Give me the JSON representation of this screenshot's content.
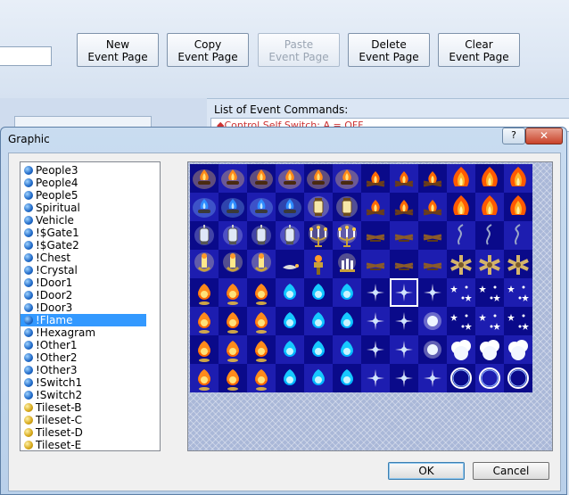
{
  "background": {
    "buttons": [
      {
        "line1": "New",
        "line2": "Event Page",
        "disabled": false
      },
      {
        "line1": "Copy",
        "line2": "Event Page",
        "disabled": false
      },
      {
        "line1": "Paste",
        "line2": "Event Page",
        "disabled": true
      },
      {
        "line1": "Delete",
        "line2": "Event Page",
        "disabled": false
      },
      {
        "line1": "Clear",
        "line2": "Event Page",
        "disabled": false
      }
    ],
    "list_label": "List of Event Commands:",
    "first_command": "◆Control Self Switch: A = OFF"
  },
  "dialog": {
    "title": "Graphic",
    "help_label": "?",
    "close_label": "✕",
    "ok_label": "OK",
    "cancel_label": "Cancel"
  },
  "list": {
    "selected": "!Flame",
    "items": [
      {
        "label": "People3",
        "icon": "blue"
      },
      {
        "label": "People4",
        "icon": "blue"
      },
      {
        "label": "People5",
        "icon": "blue"
      },
      {
        "label": "Spiritual",
        "icon": "blue"
      },
      {
        "label": "Vehicle",
        "icon": "blue"
      },
      {
        "label": "!$Gate1",
        "icon": "blue"
      },
      {
        "label": "!$Gate2",
        "icon": "blue"
      },
      {
        "label": "!Chest",
        "icon": "blue"
      },
      {
        "label": "!Crystal",
        "icon": "blue"
      },
      {
        "label": "!Door1",
        "icon": "blue"
      },
      {
        "label": "!Door2",
        "icon": "blue"
      },
      {
        "label": "!Door3",
        "icon": "blue"
      },
      {
        "label": "!Flame",
        "icon": "blue"
      },
      {
        "label": "!Hexagram",
        "icon": "blue"
      },
      {
        "label": "!Other1",
        "icon": "blue"
      },
      {
        "label": "!Other2",
        "icon": "blue"
      },
      {
        "label": "!Other3",
        "icon": "blue"
      },
      {
        "label": "!Switch1",
        "icon": "blue"
      },
      {
        "label": "!Switch2",
        "icon": "blue"
      },
      {
        "label": "Tileset-B",
        "icon": "gold"
      },
      {
        "label": "Tileset-C",
        "icon": "gold"
      },
      {
        "label": "Tileset-D",
        "icon": "gold"
      },
      {
        "label": "Tileset-E",
        "icon": "gold"
      }
    ]
  },
  "sheet": {
    "columns": 12,
    "rows": 8,
    "selected_cell": {
      "row": 4,
      "col": 7
    },
    "row_types": [
      [
        "torch-orange",
        "torch-orange",
        "torch-orange",
        "torch-orange",
        "torch-orange",
        "torch-orange",
        "campfire",
        "campfire",
        "campfire",
        "big-flame",
        "big-flame",
        "big-flame"
      ],
      [
        "torch-blue",
        "torch-blue",
        "torch-blue",
        "torch-blue",
        "lantern",
        "lantern",
        "campfire",
        "campfire",
        "campfire",
        "big-flame",
        "big-flame",
        "big-flame"
      ],
      [
        "lamp",
        "lamp",
        "lamp",
        "lamp",
        "candelabra",
        "candelabra",
        "logs",
        "logs",
        "logs",
        "smoke",
        "smoke",
        "smoke"
      ],
      [
        "sconce",
        "sconce",
        "sconce",
        "lamp-oil",
        "brazier",
        "candles",
        "logs",
        "logs",
        "logs",
        "stick-bundle",
        "stick-bundle",
        "stick-bundle"
      ],
      [
        "fireball",
        "fireball",
        "fireball",
        "bluefire",
        "bluefire",
        "bluefire",
        "sparkle",
        "sparkle",
        "sparkle",
        "stars",
        "stars",
        "stars"
      ],
      [
        "fireball",
        "fireball",
        "fireball",
        "bluefire",
        "bluefire",
        "bluefire",
        "sparkle",
        "sparkle",
        "glow",
        "stars",
        "stars",
        "stars"
      ],
      [
        "fireball",
        "fireball",
        "fireball",
        "bluefire",
        "bluefire",
        "bluefire",
        "sparkle",
        "sparkle",
        "glow",
        "cloud",
        "cloud",
        "cloud"
      ],
      [
        "fireball",
        "fireball",
        "fireball",
        "bluefire",
        "bluefire",
        "bluefire",
        "sparkle",
        "sparkle",
        "sparkle",
        "ring",
        "ring",
        "ring"
      ]
    ]
  }
}
